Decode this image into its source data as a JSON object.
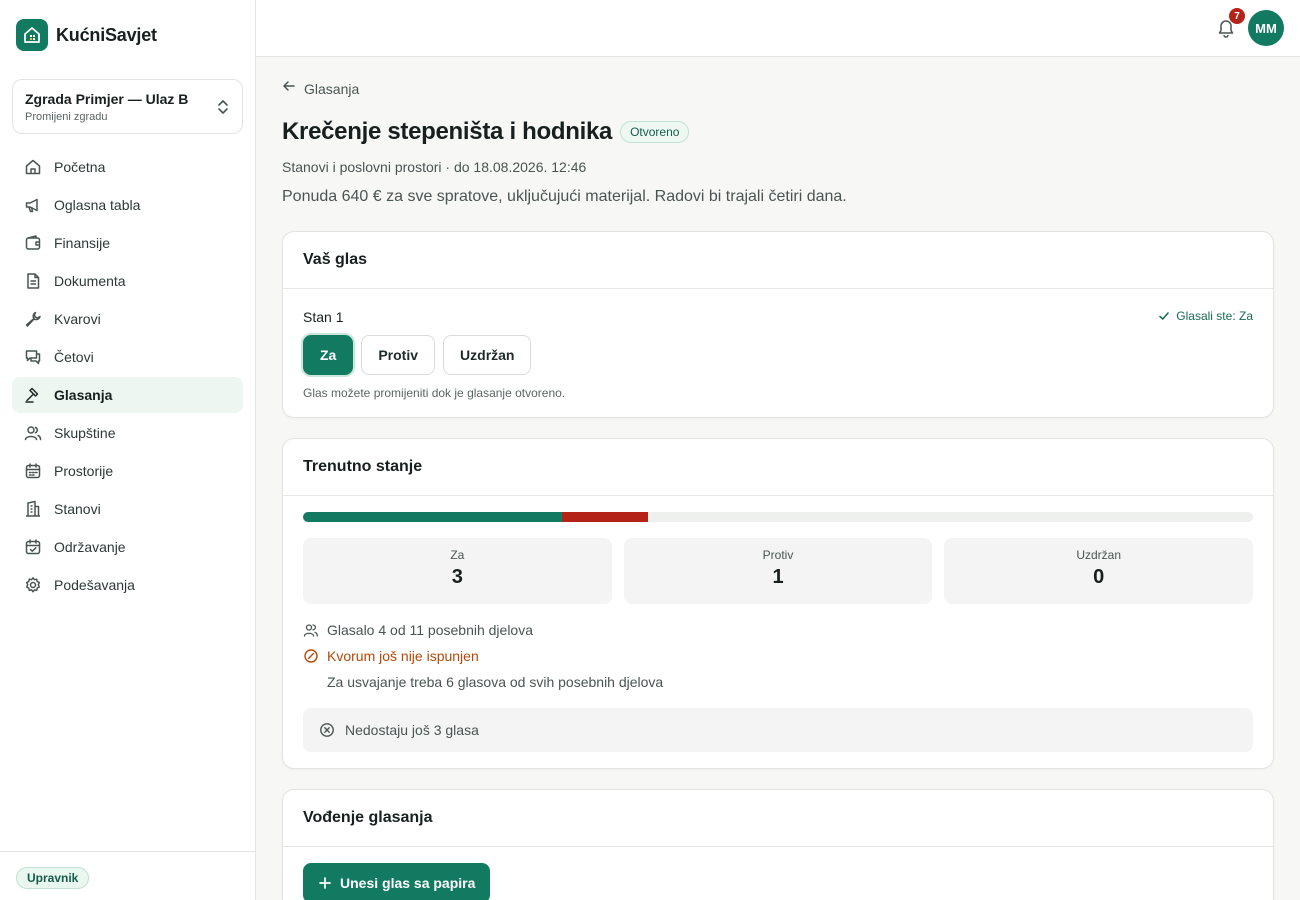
{
  "app": {
    "name": "KućniSavjet"
  },
  "building": {
    "name": "Zgrada Primjer — Ulaz B",
    "action": "Promijeni zgradu"
  },
  "sidebar": {
    "items": [
      {
        "label": "Početna",
        "icon": "home-icon"
      },
      {
        "label": "Oglasna tabla",
        "icon": "megaphone-icon"
      },
      {
        "label": "Finansije",
        "icon": "wallet-icon"
      },
      {
        "label": "Dokumenta",
        "icon": "document-icon"
      },
      {
        "label": "Kvarovi",
        "icon": "wrench-icon"
      },
      {
        "label": "Četovi",
        "icon": "chat-icon"
      },
      {
        "label": "Glasanja",
        "icon": "gavel-icon",
        "active": true
      },
      {
        "label": "Skupštine",
        "icon": "users-icon"
      },
      {
        "label": "Prostorije",
        "icon": "calendar-icon"
      },
      {
        "label": "Stanovi",
        "icon": "building-icon"
      },
      {
        "label": "Održavanje",
        "icon": "calendar-check-icon"
      },
      {
        "label": "Podešavanja",
        "icon": "gear-icon"
      }
    ],
    "role": "Upravnik"
  },
  "topbar": {
    "notifications": "7",
    "avatar_initials": "MM"
  },
  "page": {
    "back_label": "Glasanja",
    "title": "Krečenje stepeništa i hodnika",
    "status": "Otvoreno",
    "meta": "Stanovi i poslovni prostori · do 18.08.2026. 12:46",
    "description": "Ponuda 640 € za sve spratove, uključujući materijal. Radovi bi trajali četiri dana."
  },
  "your_vote": {
    "title": "Vaš glas",
    "unit": "Stan 1",
    "voted_label": "Glasali ste: Za",
    "options": [
      "Za",
      "Protiv",
      "Uzdržan"
    ],
    "selected": "Za",
    "hint": "Glas možete promijeniti dok je glasanje otvoreno."
  },
  "status_card": {
    "title": "Trenutno stanje",
    "for_label": "Za",
    "for_value": "3",
    "against_label": "Protiv",
    "against_value": "1",
    "abstain_label": "Uzdržan",
    "abstain_value": "0",
    "total_parts": 11,
    "turnout": "Glasalo 4 od 11 posebnih djelova",
    "quorum": "Kvorum još nije ispunjen",
    "requirement": "Za usvajanje treba 6 glasova od svih posebnih djelova",
    "missing": "Nedostaju još 3 glasa",
    "colors": {
      "for": "#137a62",
      "against": "#b42318"
    }
  },
  "management": {
    "title": "Vođenje glasanja",
    "paper_vote_button": "Unesi glas sa papira"
  }
}
